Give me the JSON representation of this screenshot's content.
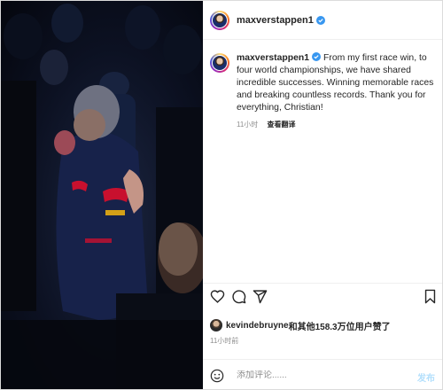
{
  "post": {
    "username": "maxverstappen1",
    "caption": "From my first race win, to four world championships, we have shared incredible successes. Winning memorable races and breaking countless records. Thank you for everything, Christian!",
    "caption_time": "11小时",
    "translate_label": "查看翻译"
  },
  "likes": {
    "liker": "kevindebruyne",
    "rest": "和其他158.3万位用户赞了",
    "time": "11小时前"
  },
  "comment": {
    "placeholder": "添加评论......",
    "post_label": "发布"
  },
  "icons": {
    "like": "heart-icon",
    "comment": "comment-icon",
    "share": "share-icon",
    "save": "bookmark-icon",
    "verified": "verified-badge-icon",
    "emoji": "emoji-icon"
  },
  "colors": {
    "verified": "#3897f0",
    "post_button_disabled": "#b2dffc",
    "muted_text": "#8e8e8e"
  }
}
